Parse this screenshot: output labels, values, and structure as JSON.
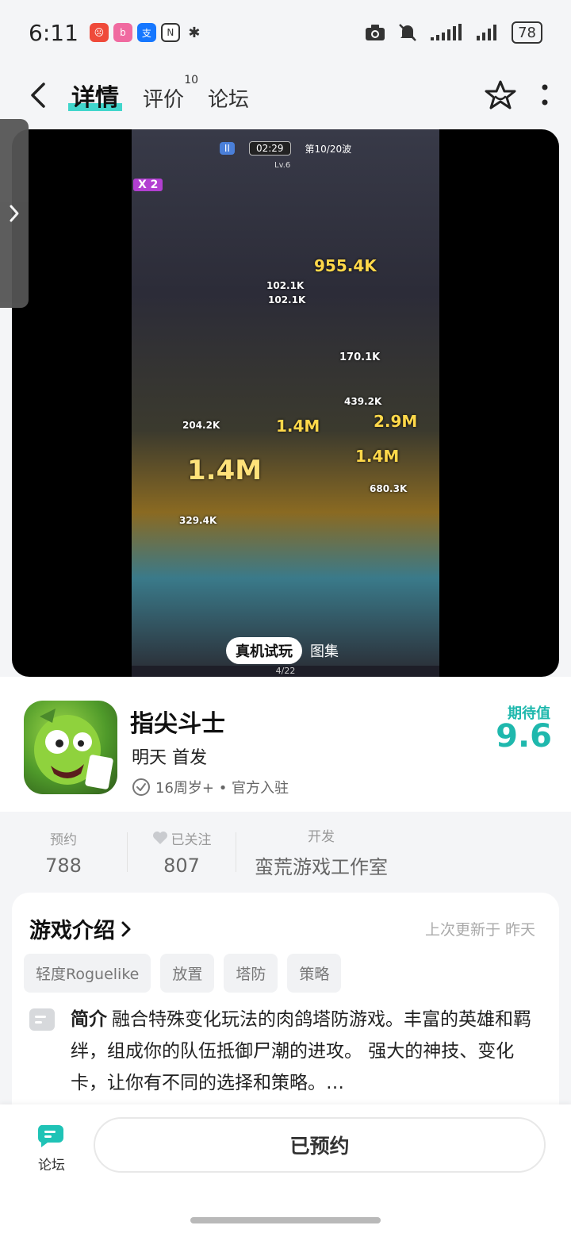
{
  "status_bar": {
    "time": "6:11",
    "battery": "78"
  },
  "header": {
    "tabs": [
      {
        "label": "详情",
        "active": true
      },
      {
        "label": "评价",
        "count": "10"
      },
      {
        "label": "论坛"
      }
    ]
  },
  "media": {
    "screenshot": {
      "wave": "第10/20波",
      "timer": "02:29",
      "level": "Lv.6",
      "multiplier": "X 2",
      "progress": "4/22",
      "damage_numbers": [
        "955.4K",
        "102.1K",
        "102.1K",
        "170.1K",
        "1.4M",
        "2.9M",
        "1.4M",
        "1.4M",
        "329.4K",
        "680.3K",
        "439.2K",
        "204.2K"
      ]
    },
    "trial_button": "真机试玩",
    "gallery_label": "图集"
  },
  "game": {
    "name": "指尖斗士",
    "release": "明天 首发",
    "meta": "16周岁+ • 官方入驻",
    "expect_label": "期待值",
    "expect_score": "9.6"
  },
  "stats": [
    {
      "label": "预约",
      "value": "788"
    },
    {
      "label": "已关注",
      "value": "807"
    },
    {
      "label": "开发",
      "value": "蛮荒游戏工作室"
    }
  ],
  "intro": {
    "title": "游戏介绍",
    "updated": "上次更新于 昨天",
    "tags": [
      "轻度Roguelike",
      "放置",
      "塔防",
      "策略"
    ],
    "summary_label": "简介",
    "summary": "融合特殊变化玩法的肉鸽塔防游戏。丰富的英雄和羁绊，组成你的队伍抵御尸潮的进攻。 强大的神技、变化卡，让你有不同的选择和策略。…"
  },
  "bottom": {
    "forum_label": "论坛",
    "reserve_label": "已预约"
  },
  "colors": {
    "accent": "#1fb8ad",
    "tab_highlight": "#2ed3c6"
  }
}
